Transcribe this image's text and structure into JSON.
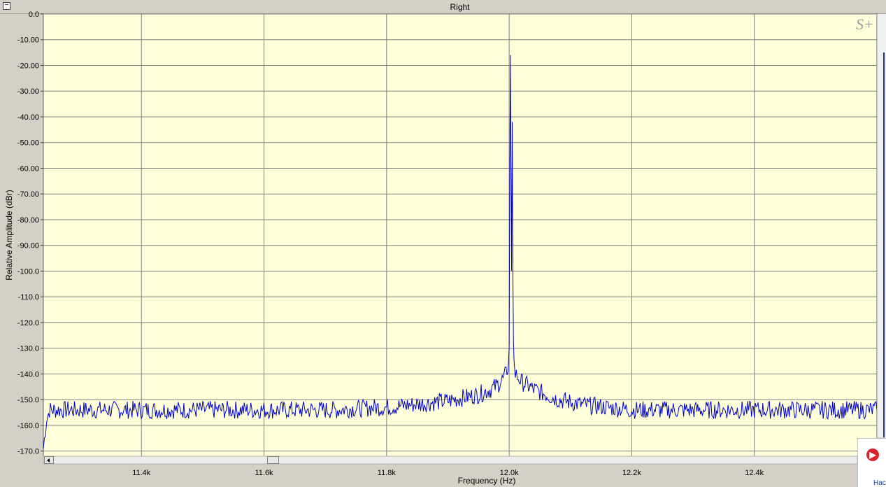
{
  "window": {
    "title": "Right",
    "collapse_glyph": "−"
  },
  "side_panel": {
    "icon_glyph": "▶",
    "partial_text": "Hac"
  },
  "chart_data": {
    "type": "line",
    "xlabel": "Frequency (Hz)",
    "ylabel": "Relative Amplitude (dBr)",
    "xlim": [
      11240,
      12600
    ],
    "ylim": [
      -172,
      0
    ],
    "x_ticks": [
      {
        "value": 11400,
        "label": "11.4k"
      },
      {
        "value": 11600,
        "label": "11.6k"
      },
      {
        "value": 11800,
        "label": "11.8k"
      },
      {
        "value": 12000,
        "label": "12.0k"
      },
      {
        "value": 12200,
        "label": "12.2k"
      },
      {
        "value": 12400,
        "label": "12.4k"
      }
    ],
    "y_ticks": [
      {
        "value": 0,
        "label": "0.0"
      },
      {
        "value": -10,
        "label": "-10.00"
      },
      {
        "value": -20,
        "label": "-20.00"
      },
      {
        "value": -30,
        "label": "-30.00"
      },
      {
        "value": -40,
        "label": "-40.00"
      },
      {
        "value": -50,
        "label": "-50.00"
      },
      {
        "value": -60,
        "label": "-60.00"
      },
      {
        "value": -70,
        "label": "-70.00"
      },
      {
        "value": -80,
        "label": "-80.00"
      },
      {
        "value": -90,
        "label": "-90.00"
      },
      {
        "value": -100,
        "label": "-100.0"
      },
      {
        "value": -110,
        "label": "-110.0"
      },
      {
        "value": -120,
        "label": "-120.0"
      },
      {
        "value": -130,
        "label": "-130.0"
      },
      {
        "value": -140,
        "label": "-140.0"
      },
      {
        "value": -150,
        "label": "-150.0"
      },
      {
        "value": -160,
        "label": "-160.0"
      },
      {
        "value": -170,
        "label": "-170.0"
      }
    ],
    "grid": true,
    "logo_text": "S+",
    "colors": {
      "plot_background": "#ffffd9",
      "grid": "#808080",
      "line": "#0000c8"
    },
    "series": [
      {
        "x": [
          11240,
          11245,
          11250,
          11260,
          11280,
          11300,
          11320,
          11340,
          11360,
          11380,
          11400,
          11420,
          11440,
          11460,
          11480,
          11500,
          11520,
          11540,
          11560,
          11580,
          11600,
          11620,
          11640,
          11660,
          11680,
          11700,
          11720,
          11740,
          11760,
          11780,
          11800,
          11820,
          11840,
          11860,
          11880,
          11900,
          11920,
          11940,
          11950,
          11960,
          11970,
          11980,
          11990,
          11995,
          11998,
          12000,
          12001,
          12002,
          12003,
          12004,
          12005,
          12006,
          12007,
          12008,
          12010,
          12015,
          12020,
          12030,
          12040,
          12050,
          12060,
          12070,
          12080,
          12090,
          12100,
          12120,
          12140,
          12160,
          12180,
          12200,
          12220,
          12240,
          12260,
          12280,
          12300,
          12320,
          12340,
          12360,
          12380,
          12400,
          12420,
          12440,
          12460,
          12480,
          12500,
          12520,
          12540,
          12560,
          12580,
          12600
        ],
        "y": [
          -169,
          -158,
          -154,
          -154,
          -154,
          -154,
          -154,
          -154,
          -154,
          -154,
          -154,
          -154,
          -154,
          -154,
          -154,
          -154,
          -154,
          -154,
          -154,
          -154,
          -154,
          -154,
          -154,
          -154,
          -154,
          -154,
          -154,
          -153.5,
          -153.5,
          -153,
          -153,
          -152.5,
          -152,
          -151.5,
          -151,
          -150.5,
          -149.5,
          -148.5,
          -148,
          -147,
          -146,
          -144.5,
          -142,
          -140,
          -137,
          -130,
          -60,
          -16,
          -60,
          -100,
          -42,
          -100,
          -128,
          -136,
          -140,
          -141.5,
          -143,
          -144.5,
          -146,
          -147,
          -148,
          -149,
          -150,
          -150.5,
          -151,
          -152,
          -152.5,
          -153,
          -153.5,
          -154,
          -154,
          -154,
          -154,
          -154,
          -154,
          -154,
          -154,
          -154,
          -154,
          -154,
          -154,
          -154,
          -154,
          -154,
          -154,
          -154,
          -154,
          -154,
          -154,
          -154
        ]
      }
    ]
  }
}
